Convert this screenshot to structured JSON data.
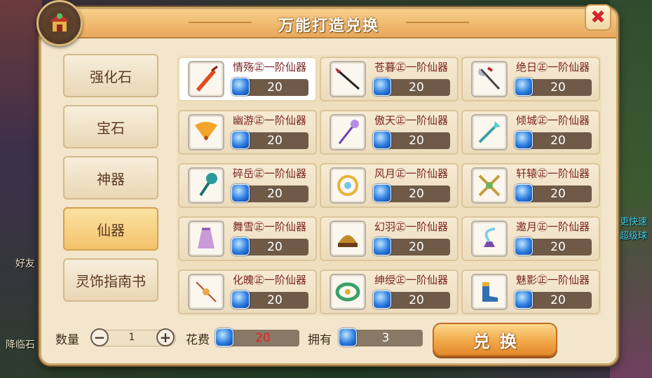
{
  "window": {
    "title": "万能打造兑换"
  },
  "tabs": [
    {
      "label": "强化石",
      "active": false
    },
    {
      "label": "宝石",
      "active": false
    },
    {
      "label": "神器",
      "active": false
    },
    {
      "label": "仙器",
      "active": true
    },
    {
      "label": "灵饰指南书",
      "active": false
    }
  ],
  "items": [
    {
      "name": "情殇㊣一阶仙器",
      "cost": "20",
      "icon": "sword-icon",
      "selected": true
    },
    {
      "name": "苍暮㊣一阶仙器",
      "cost": "20",
      "icon": "spear-icon"
    },
    {
      "name": "绝日㊣一阶仙器",
      "cost": "20",
      "icon": "axe-icon"
    },
    {
      "name": "幽游㊣一阶仙器",
      "cost": "20",
      "icon": "fan-icon"
    },
    {
      "name": "傲天㊣一阶仙器",
      "cost": "20",
      "icon": "staff-icon"
    },
    {
      "name": "倾城㊣一阶仙器",
      "cost": "20",
      "icon": "claw-icon"
    },
    {
      "name": "碎岳㊣一阶仙器",
      "cost": "20",
      "icon": "hammer-icon"
    },
    {
      "name": "风月㊣一阶仙器",
      "cost": "20",
      "icon": "ring-icon"
    },
    {
      "name": "轩辕㊣一阶仙器",
      "cost": "20",
      "icon": "cross-blade-icon"
    },
    {
      "name": "舞雪㊣一阶仙器",
      "cost": "20",
      "icon": "dress-icon"
    },
    {
      "name": "幻羽㊣一阶仙器",
      "cost": "20",
      "icon": "helmet-icon"
    },
    {
      "name": "邀月㊣一阶仙器",
      "cost": "20",
      "icon": "lamp-icon"
    },
    {
      "name": "化魄㊣一阶仙器",
      "cost": "20",
      "icon": "necklace-icon"
    },
    {
      "name": "绅绶㊣一阶仙器",
      "cost": "20",
      "icon": "belt-icon"
    },
    {
      "name": "魅影㊣一阶仙器",
      "cost": "20",
      "icon": "boots-icon"
    }
  ],
  "footer": {
    "quantity_label": "数量",
    "quantity_value": "1",
    "minus": "−",
    "plus": "+",
    "cost_label": "花费",
    "cost_value": "20",
    "own_label": "拥有",
    "own_value": "3",
    "exchange_label": "兑换"
  },
  "close_symbol": "✖",
  "background": {
    "left_texts": [
      "好友",
      "降临石"
    ],
    "right_texts": [
      "更快速",
      "超级球"
    ]
  },
  "colors": {
    "panel_bg": "#f3e6cc",
    "title_bar": "#e9a85a",
    "item_name": "#7a2525",
    "cost_bar": "#6f5a48",
    "cost_highlight": "#e02424",
    "gem_blue": "#2e7fe0",
    "exchange_button": "#f2a94a",
    "close_red": "#d0262d"
  }
}
